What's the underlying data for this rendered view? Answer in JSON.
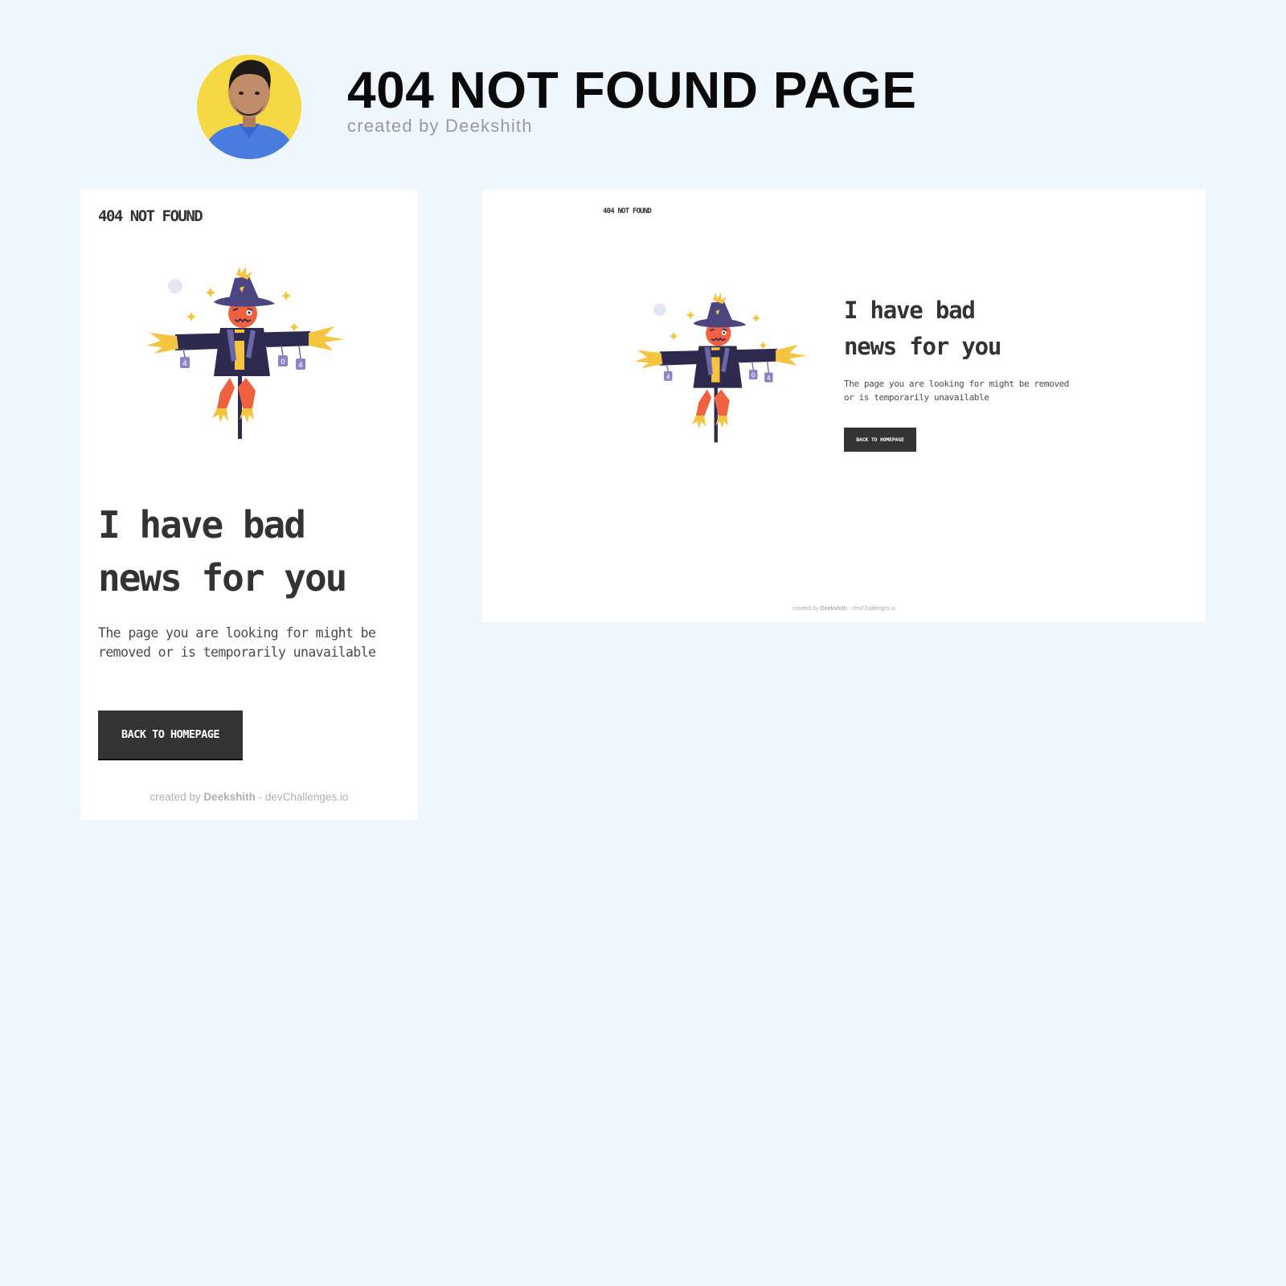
{
  "header": {
    "title": "404 NOT FOUND PAGE",
    "subtitle": "created by Deekshith"
  },
  "colors": {
    "background": "#eef6fe",
    "card": "#ffffff",
    "button": "#333333",
    "avatar_ring": "#f6d844",
    "scarecrow_coat": "#2d2a4e",
    "scarecrow_face": "#f0623f",
    "straw": "#f5c542"
  },
  "mobile": {
    "logo": "404 NOT FOUND",
    "heading_line1": "I have bad",
    "heading_line2": "news for you",
    "description": "The page you are looking for might be removed or is temporarily unavailable",
    "button_label": "BACK TO HOMEPAGE",
    "footer_prefix": "created by ",
    "footer_author": "Deekshith",
    "footer_suffix": " - devChallenges.io"
  },
  "desktop": {
    "logo": "404 NOT FOUND",
    "heading_line1": "I have bad",
    "heading_line2": "news for you",
    "description_line1": "The page you are looking for might be removed",
    "description_line2": "or is temporarily unavailable",
    "button_label": "BACK TO HOMEPAGE",
    "footer_prefix": "created by ",
    "footer_author": "Deekshith",
    "footer_suffix": " - devChallenges.io"
  },
  "illustration": {
    "icon": "scarecrow-illustration",
    "tag_left": "4",
    "tag_mid": "0",
    "tag_right": "4"
  }
}
